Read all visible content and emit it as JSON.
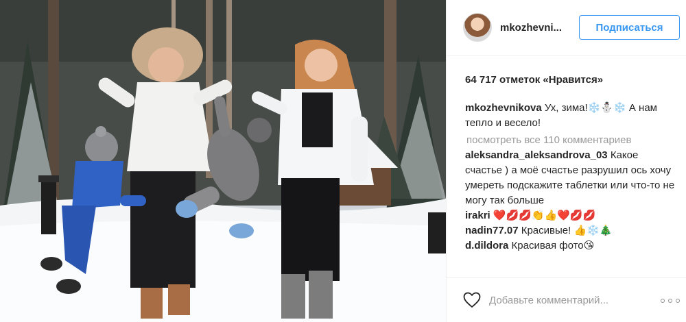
{
  "post": {
    "username": "mkozhevni...",
    "follow_label": "Подписаться",
    "likes_text": "64 717 отметок «Нравится»",
    "caption": {
      "user": "mkozhevnikova",
      "text": "Ух, зима!❄️⛄❄️ А нам тепло и весело!"
    },
    "view_all_text": "посмотреть все 110 комментариев",
    "comments": [
      {
        "user": "aleksandra_aleksandrova_03",
        "text": "Какое счастье ) а моё счастье разрушил ось хочу умереть подскажите таблетки или что-то не могу так больше"
      },
      {
        "user": "irakri",
        "text": "❤️💋💋👏👍❤️💋💋"
      },
      {
        "user": "nadin77.07",
        "text": "Красивые! 👍❄️🎄"
      },
      {
        "user": "d.dildora",
        "text": "Красивая фото😘"
      },
      {
        "user": "",
        "text": ""
      }
    ],
    "add_comment_placeholder": "Добавьте комментарий..."
  },
  "colors": {
    "accent": "#3897f0",
    "text": "#262626",
    "muted": "#999999",
    "divider": "#efefef"
  },
  "icons": {
    "like": "heart-outline-icon",
    "more": "ellipsis-icon"
  }
}
